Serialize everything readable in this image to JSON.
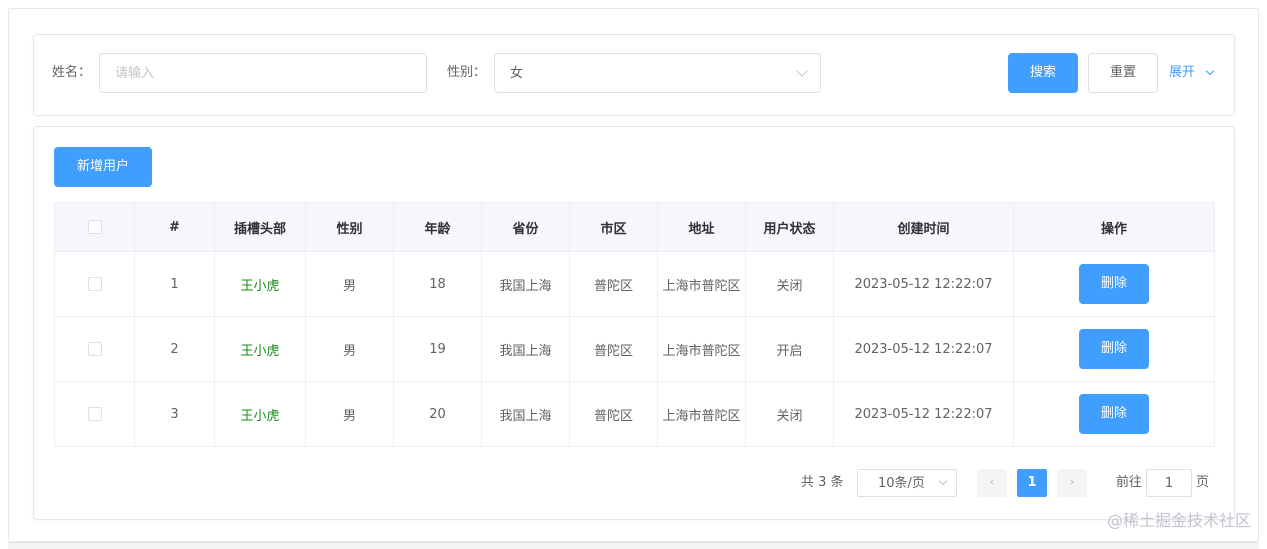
{
  "search": {
    "name_label": "姓名：",
    "name_placeholder": "请输入",
    "gender_label": "性别：",
    "gender_value": "女",
    "search_btn": "搜索",
    "reset_btn": "重置",
    "expand_link": "展开"
  },
  "toolbar": {
    "add_btn": "新增用户"
  },
  "table": {
    "headers": [
      "#",
      "插槽头部",
      "性别",
      "年龄",
      "省份",
      "市区",
      "地址",
      "用户状态",
      "创建时间",
      "操作"
    ],
    "rows": [
      {
        "index": "1",
        "name": "王小虎",
        "gender": "男",
        "age": "18",
        "province": "我国上海",
        "district": "普陀区",
        "address": "上海市普陀区",
        "status": "关闭",
        "created": "2023-05-12 12:22:07",
        "action": "删除"
      },
      {
        "index": "2",
        "name": "王小虎",
        "gender": "男",
        "age": "19",
        "province": "我国上海",
        "district": "普陀区",
        "address": "上海市普陀区",
        "status": "开启",
        "created": "2023-05-12 12:22:07",
        "action": "删除"
      },
      {
        "index": "3",
        "name": "王小虎",
        "gender": "男",
        "age": "20",
        "province": "我国上海",
        "district": "普陀区",
        "address": "上海市普陀区",
        "status": "关闭",
        "created": "2023-05-12 12:22:07",
        "action": "删除"
      }
    ]
  },
  "pagination": {
    "total": "共 3 条",
    "page_size": "10条/页",
    "current_page": "1",
    "goto_label": "前往",
    "goto_value": "1",
    "page_suffix": "页"
  },
  "watermark": "@稀土掘金技术社区",
  "colors": {
    "primary": "#409eff",
    "name_text": "#1a8a1a"
  }
}
